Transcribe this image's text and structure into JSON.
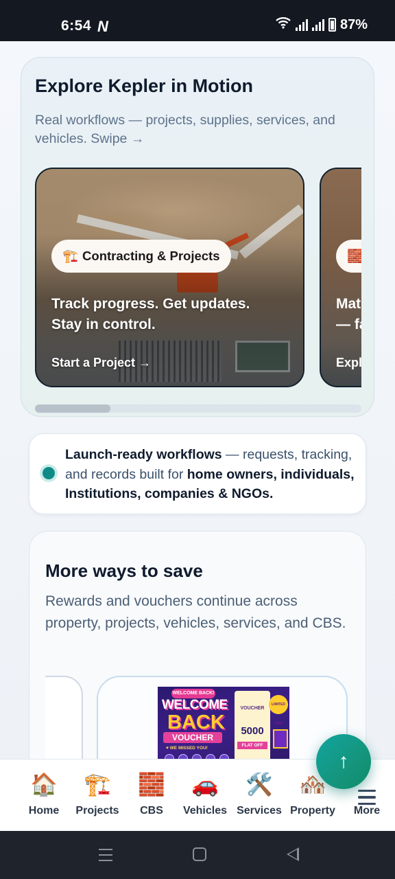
{
  "status_bar": {
    "time": "6:54",
    "notification_icon": "N",
    "battery": "87%"
  },
  "explore": {
    "title": "Explore Kepler in Motion",
    "subtitle": "Real workflows — projects, supplies, services, and vehicles. Swipe →",
    "slides": [
      {
        "chip_icon": "🏗️",
        "chip_label": "Contracting & Projects",
        "headline": "Track progress. Get updates. Stay in control.",
        "link": "Start a Project →"
      },
      {
        "chip_icon": "🧱",
        "headline": "Mat\n— fa",
        "link": "Expl"
      }
    ]
  },
  "launch": {
    "bold_lead": "Launch-ready workflows",
    "middle": " — requests, tracking, and records built for ",
    "bold_tail": "home owners, individuals, Institutions, companies & NGOs."
  },
  "save": {
    "title": "More ways to save",
    "subtitle": "Rewards and vouchers continue across property, projects, vehicles, services, and CBS.",
    "voucher": {
      "welcome_tag": "WELCOME BACK!",
      "line1": "WELCOME",
      "line2": "BACK",
      "line3": "VOUCHER",
      "missed": "♥ WE MISSED YOU!",
      "ticket_label": "VOUCHER",
      "ticket_amount": "5000",
      "ticket_flat": "FLAT OFF",
      "badge": "LIMITED TIME"
    }
  },
  "fab": {
    "icon": "↑"
  },
  "bottom_nav": [
    {
      "icon": "🏠",
      "label": "Home"
    },
    {
      "icon": "🏗️",
      "label": "Projects"
    },
    {
      "icon": "🧱",
      "label": "CBS"
    },
    {
      "icon": "🚗",
      "label": "Vehicles"
    },
    {
      "icon": "🛠️",
      "label": "Services"
    },
    {
      "icon": "🏘️",
      "label": "Property"
    },
    {
      "icon": "menu-icon",
      "label": "More"
    }
  ]
}
